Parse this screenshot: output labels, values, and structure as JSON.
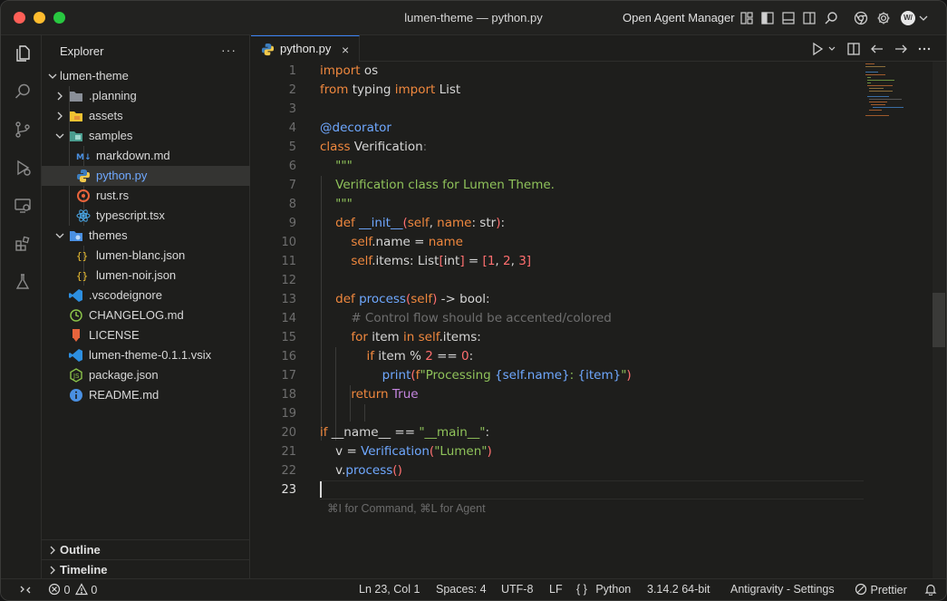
{
  "window": {
    "title": "lumen-theme — python.py",
    "agent_manager_label": "Open Agent Manager",
    "avatar_text": "W/"
  },
  "explorer": {
    "title": "Explorer",
    "more": "···",
    "root": "lumen-theme",
    "items": [
      {
        "label": ".planning"
      },
      {
        "label": "assets"
      },
      {
        "label": "samples"
      },
      {
        "label": "markdown.md"
      },
      {
        "label": "python.py"
      },
      {
        "label": "rust.rs"
      },
      {
        "label": "typescript.tsx"
      },
      {
        "label": "themes"
      },
      {
        "label": "lumen-blanc.json"
      },
      {
        "label": "lumen-noir.json"
      },
      {
        "label": ".vscodeignore"
      },
      {
        "label": "CHANGELOG.md"
      },
      {
        "label": "LICENSE"
      },
      {
        "label": "lumen-theme-0.1.1.vsix"
      },
      {
        "label": "package.json"
      },
      {
        "label": "README.md"
      }
    ],
    "outline": "Outline",
    "timeline": "Timeline"
  },
  "editor": {
    "tab_label": "python.py",
    "tab_close": "×",
    "line_numbers": [
      "1",
      "2",
      "3",
      "4",
      "5",
      "6",
      "7",
      "8",
      "9",
      "10",
      "11",
      "12",
      "13",
      "14",
      "15",
      "16",
      "17",
      "18",
      "19",
      "20",
      "21",
      "22",
      "23"
    ],
    "inline_hint": "⌘I for Command, ⌘L for Agent"
  },
  "status": {
    "errors": "0",
    "warnings": "0",
    "position": "Ln 23, Col 1",
    "spaces": "Spaces: 4",
    "encoding": "UTF-8",
    "eol": "LF",
    "language_braces": "{ }",
    "language": "Python",
    "interpreter": "3.14.2 64-bit",
    "settings": "Antigravity - Settings",
    "formatter": "Prettier"
  },
  "colors": {
    "accent": "#3a82f6",
    "keyword": "#f0883e",
    "function": "#6fa8ff",
    "string": "#8fc25a",
    "number": "#ff6e6e",
    "comment": "#6e6e6e"
  }
}
